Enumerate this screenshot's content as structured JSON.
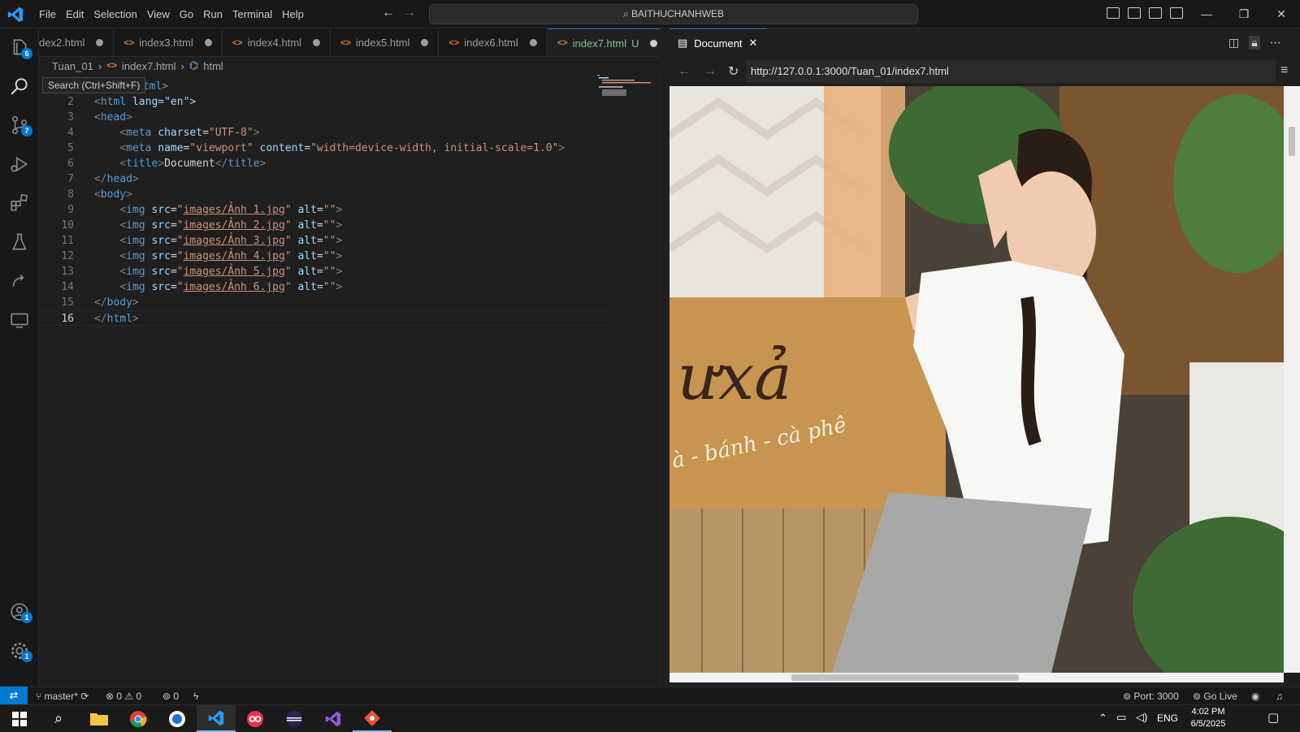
{
  "menu": [
    "File",
    "Edit",
    "Selection",
    "View",
    "Go",
    "Run",
    "Terminal",
    "Help"
  ],
  "command_center": "BAITHUCHANHWEB",
  "tabs": [
    {
      "label": "dex2.html"
    },
    {
      "label": "index3.html"
    },
    {
      "label": "index4.html"
    },
    {
      "label": "index5.html"
    },
    {
      "label": "index6.html"
    },
    {
      "label": "index7.html",
      "status": "U"
    }
  ],
  "breadcrumb": {
    "folder": "Tuan_01",
    "file": "index7.html",
    "symbol": "html"
  },
  "tooltip": "Search (Ctrl+Shift+F)",
  "activity_badges": {
    "explorer": "6",
    "source_control": "7",
    "accounts": "1",
    "manage": "1"
  },
  "code": {
    "line1_tail": "html>",
    "line2_tail": "lang=\"en\">",
    "head_open": "head",
    "meta1_attr": "charset",
    "meta1_val": "\"UTF-8\"",
    "meta2_name_attr": "name",
    "meta2_name_val": "\"viewport\"",
    "meta2_content_attr": "content",
    "meta2_content_val": "\"width=device-width, initial-scale=1.0\"",
    "title_text": "Document",
    "imgs": [
      "images/Ảnh 1.jpg",
      "images/Ảnh 2.jpg",
      "images/Ảnh 3.jpg",
      "images/Ảnh 4.jpg",
      "images/Ảnh 5.jpg",
      "images/Ảnh 6.jpg"
    ],
    "line_numbers": [
      "2",
      "3",
      "4",
      "5",
      "6",
      "7",
      "8",
      "9",
      "10",
      "11",
      "12",
      "13",
      "14",
      "15",
      "16"
    ]
  },
  "browser": {
    "tab_title": "Document",
    "url": "http://127.0.0.1:3000/Tuan_01/index7.html",
    "sign_text": "ưxả",
    "sign_sub": "à - bánh - cà phê"
  },
  "status": {
    "branch": "master*",
    "errors": "0",
    "warnings": "0",
    "ports": "0",
    "port": "Port: 3000",
    "golive": "Go Live"
  },
  "taskbar": {
    "lang": "ENG",
    "time": "4:02 PM",
    "date": "6/5/2025"
  }
}
